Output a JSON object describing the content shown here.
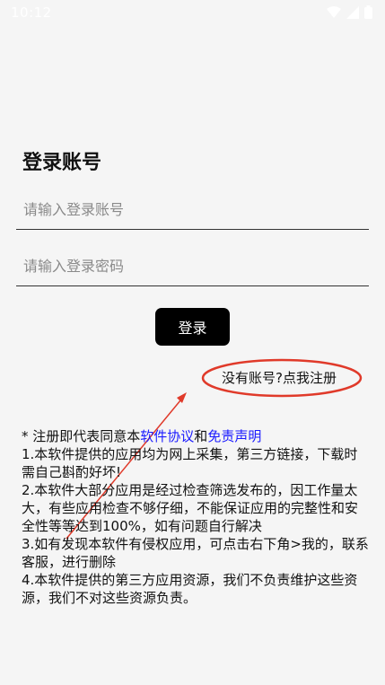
{
  "status_bar": {
    "time": "10:12",
    "icons": [
      "wifi-icon",
      "signal-icon",
      "battery-icon"
    ]
  },
  "login": {
    "title": "登录账号",
    "account_placeholder": "请输入登录账号",
    "password_placeholder": "请输入登录密码",
    "login_button": "登录",
    "register_link": "没有账号?点我注册"
  },
  "notice": {
    "prefix": "* 注册即代表同意本",
    "agreement_link": "软件协议",
    "and": "和",
    "disclaimer_link": "免责声明",
    "items": [
      "1.本软件提供的应用均为网上采集，第三方链接，下载时需自己斟酌好坏!",
      "2.本软件大部分应用是经过检查筛选发布的，因工作量太大，有些应用检查不够仔细，不能保证应用的完整性和安全性等等达到100%，如有问题自行解决",
      "3.如有发现本软件有侵权应用，可点击右下角>我的，联系客服，进行删除",
      "4.本软件提供的第三方应用资源，我们不负责维护这些资源，我们不对这些资源负责。"
    ]
  },
  "colors": {
    "background": "#f5f5f5",
    "button": "#000000",
    "link": "#1a1aff",
    "annotation": "#e03a2a"
  }
}
